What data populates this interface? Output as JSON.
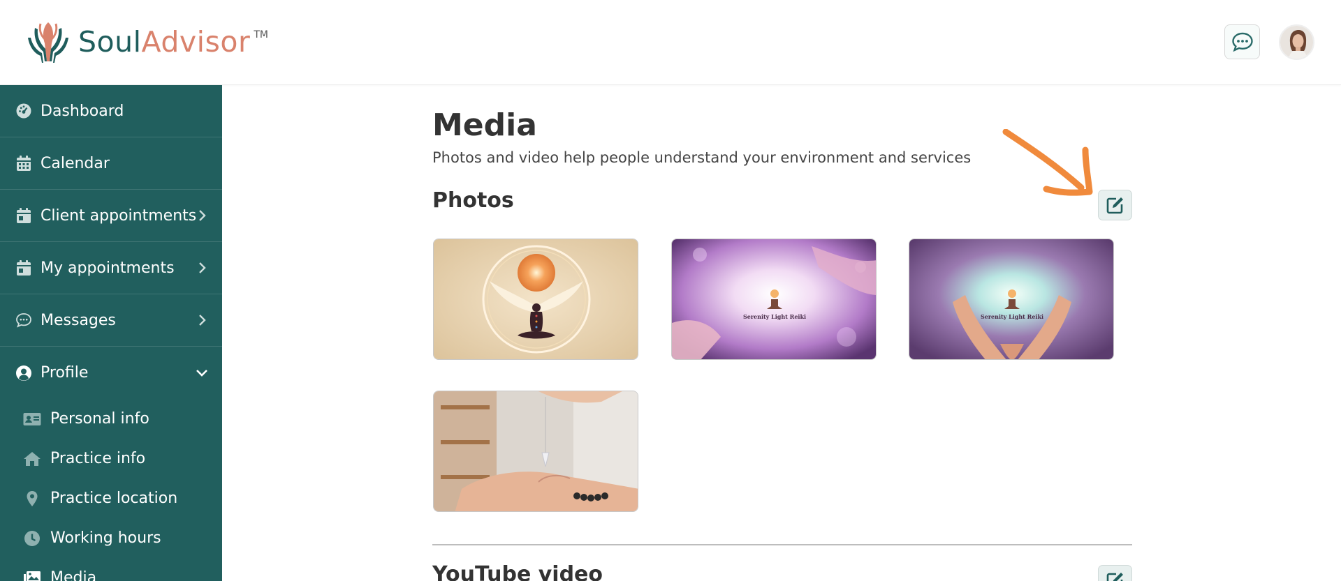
{
  "brand": {
    "name_part1": "Soul",
    "name_part2": "Advisor",
    "tm": "TM",
    "colors": {
      "teal": "#1f5d5c",
      "coral": "#d9826c"
    }
  },
  "header": {
    "chat_icon": "chat-bubble-icon",
    "avatar": "user-avatar"
  },
  "sidebar": {
    "background": "#215f5e",
    "items": [
      {
        "label": "Dashboard",
        "icon": "dashboard-gauge-icon"
      },
      {
        "label": "Calendar",
        "icon": "calendar-icon"
      },
      {
        "label": "Client appointments",
        "icon": "calendar-event-icon",
        "chevron": "right"
      },
      {
        "label": "My appointments",
        "icon": "calendar-event-icon",
        "chevron": "right"
      },
      {
        "label": "Messages",
        "icon": "chat-icon",
        "chevron": "right"
      },
      {
        "label": "Profile",
        "icon": "user-circle-icon",
        "chevron": "down",
        "expanded": true
      }
    ],
    "subitems": [
      {
        "label": "Personal info",
        "icon": "id-card-icon"
      },
      {
        "label": "Practice info",
        "icon": "home-icon"
      },
      {
        "label": "Practice location",
        "icon": "map-pin-icon"
      },
      {
        "label": "Working hours",
        "icon": "clock-icon"
      },
      {
        "label": "Media",
        "icon": "images-icon"
      }
    ]
  },
  "main": {
    "title": "Media",
    "subtitle": "Photos and video help people understand your environment and services",
    "photos_section": {
      "title": "Photos",
      "edit_icon": "edit-pencil-icon"
    },
    "photos": [
      {
        "alt": "meditation-wings-illustration"
      },
      {
        "alt": "serenity-light-reiki-hands",
        "caption": "Serenity Light Reiki"
      },
      {
        "alt": "serenity-light-reiki-open-hands",
        "caption": "Serenity Light Reiki"
      },
      {
        "alt": "pendulum-over-palm"
      }
    ],
    "youtube_section": {
      "title": "YouTube video",
      "edit_icon": "edit-pencil-icon"
    }
  },
  "annotation": {
    "arrow_color": "#f08a3c"
  }
}
